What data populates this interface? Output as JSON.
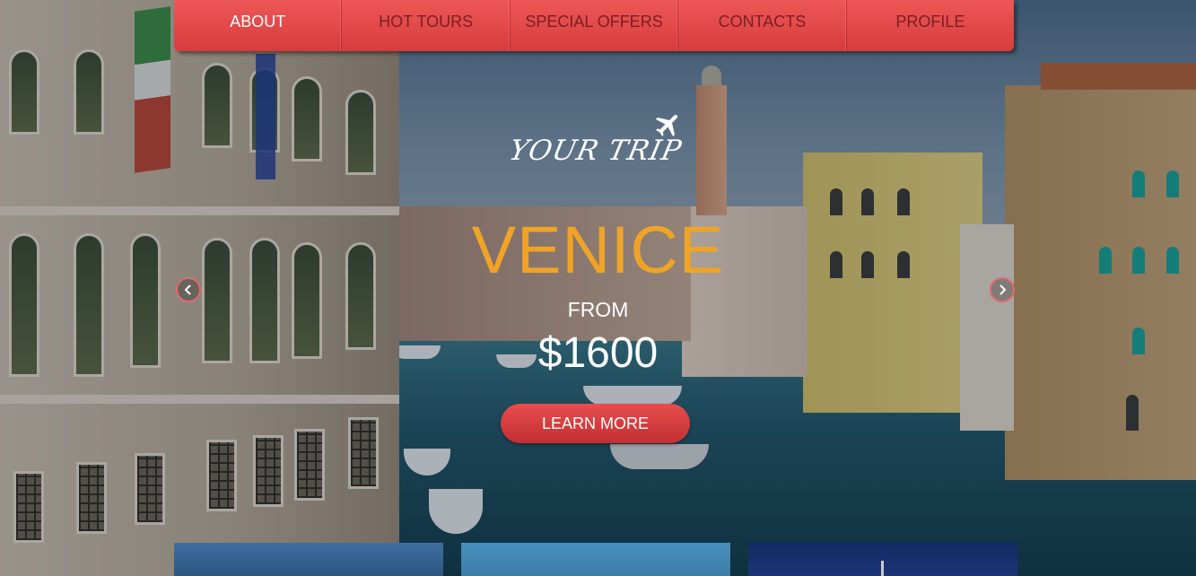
{
  "nav": {
    "items": [
      {
        "label": "ABOUT",
        "active": true
      },
      {
        "label": "HOT TOURS",
        "active": false
      },
      {
        "label": "SPECIAL OFFERS",
        "active": false
      },
      {
        "label": "CONTACTS",
        "active": false
      },
      {
        "label": "PROFILE",
        "active": false
      }
    ]
  },
  "logo": {
    "text": "YOUR TRIP",
    "icon": "airplane-icon"
  },
  "hero": {
    "city": "VENICE",
    "from_label": "FROM",
    "price": "$1600",
    "cta_label": "LEARN MORE"
  },
  "carousel": {
    "prev_icon": "chevron-left-icon",
    "next_icon": "chevron-right-icon"
  },
  "colors": {
    "nav_red": "#e24848",
    "accent_orange": "#f0a326",
    "cta_red": "#d63c3f",
    "text_white": "#ffffff"
  }
}
